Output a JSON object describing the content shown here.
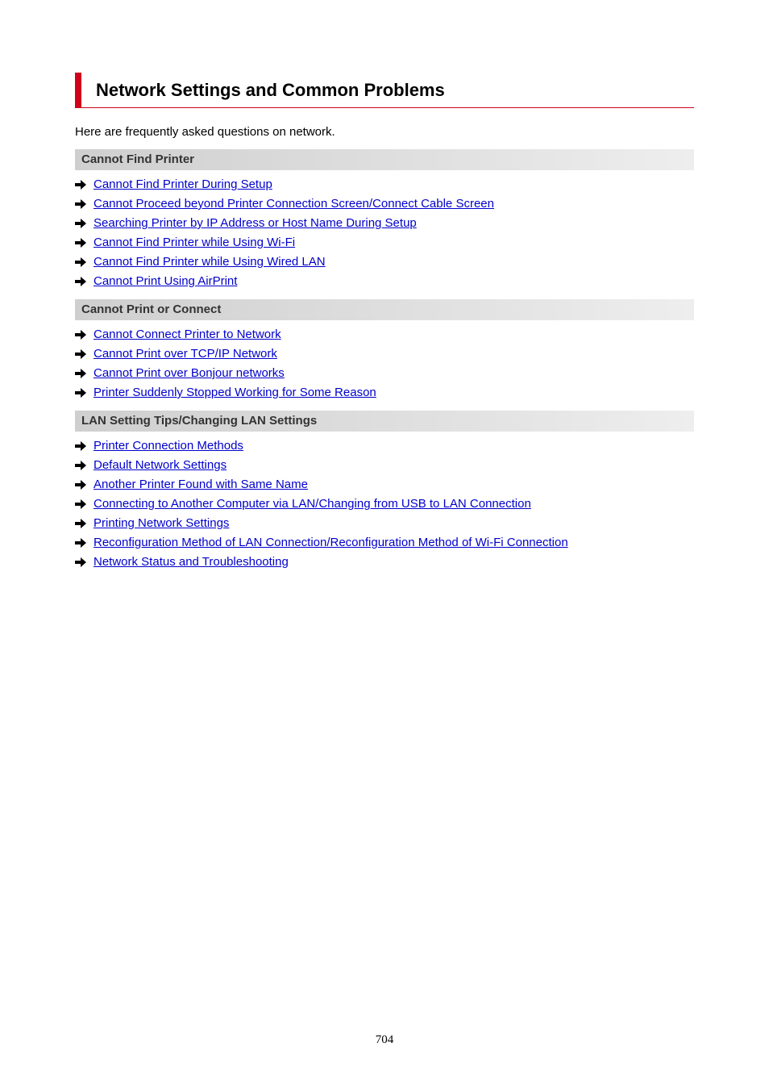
{
  "header": {
    "title": "Network Settings and Common Problems"
  },
  "intro": "Here are frequently asked questions on network.",
  "sections": [
    {
      "title": "Cannot Find Printer",
      "links": [
        "Cannot Find Printer During Setup",
        "Cannot Proceed beyond Printer Connection Screen/Connect Cable Screen",
        "Searching Printer by IP Address or Host Name During Setup",
        "Cannot Find Printer while Using Wi-Fi",
        "Cannot Find Printer while Using Wired LAN",
        "Cannot Print Using AirPrint"
      ]
    },
    {
      "title": "Cannot Print or Connect",
      "links": [
        "Cannot Connect Printer to Network",
        "Cannot Print over TCP/IP Network",
        "Cannot Print over Bonjour networks",
        "Printer Suddenly Stopped Working for Some Reason"
      ]
    },
    {
      "title": "LAN Setting Tips/Changing LAN Settings",
      "links": [
        "Printer Connection Methods",
        "Default Network Settings",
        "Another Printer Found with Same Name",
        "Connecting to Another Computer via LAN/Changing from USB to LAN Connection",
        "Printing Network Settings",
        "Reconfiguration Method of LAN Connection/Reconfiguration Method of Wi-Fi Connection",
        "Network Status and Troubleshooting"
      ]
    }
  ],
  "footer": {
    "page_number": "704"
  },
  "colors": {
    "accent": "#d0021b",
    "link": "#0000cc"
  },
  "icons": {
    "list_bullet": "arrow-right-icon"
  }
}
